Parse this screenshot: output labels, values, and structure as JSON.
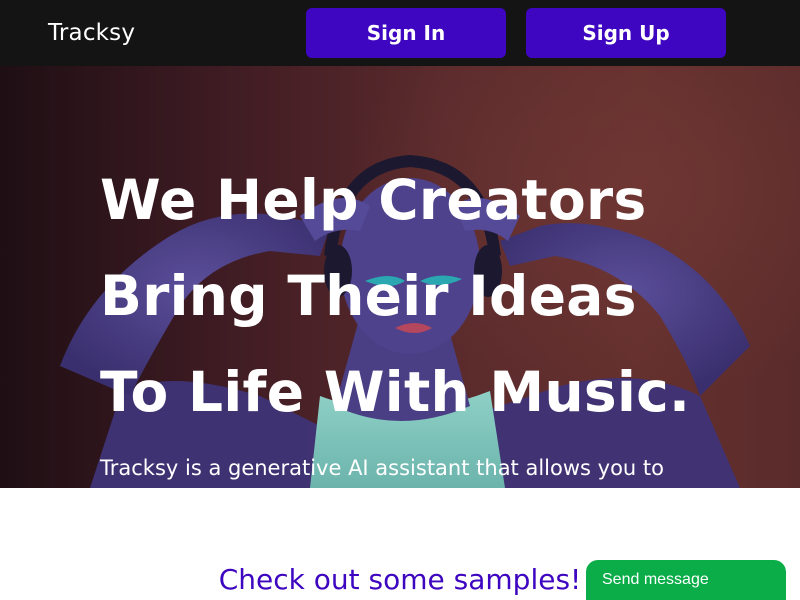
{
  "header": {
    "brand": "Tracksy",
    "sign_in_label": "Sign In",
    "sign_up_label": "Sign Up"
  },
  "hero": {
    "title_lines": [
      "We Help Creators",
      "Bring Their Ideas",
      "To Life With Music."
    ],
    "description": "Tracksy is a generative AI assistant that allows you to"
  },
  "samples": {
    "heading": "Check out some samples!"
  },
  "chat_widget": {
    "label": "Send message"
  },
  "colors": {
    "topbar_bg": "#141414",
    "brand_button": "#3e06c0",
    "heading_accent": "#3e06c0",
    "chat_widget_bg": "#0aad47"
  }
}
